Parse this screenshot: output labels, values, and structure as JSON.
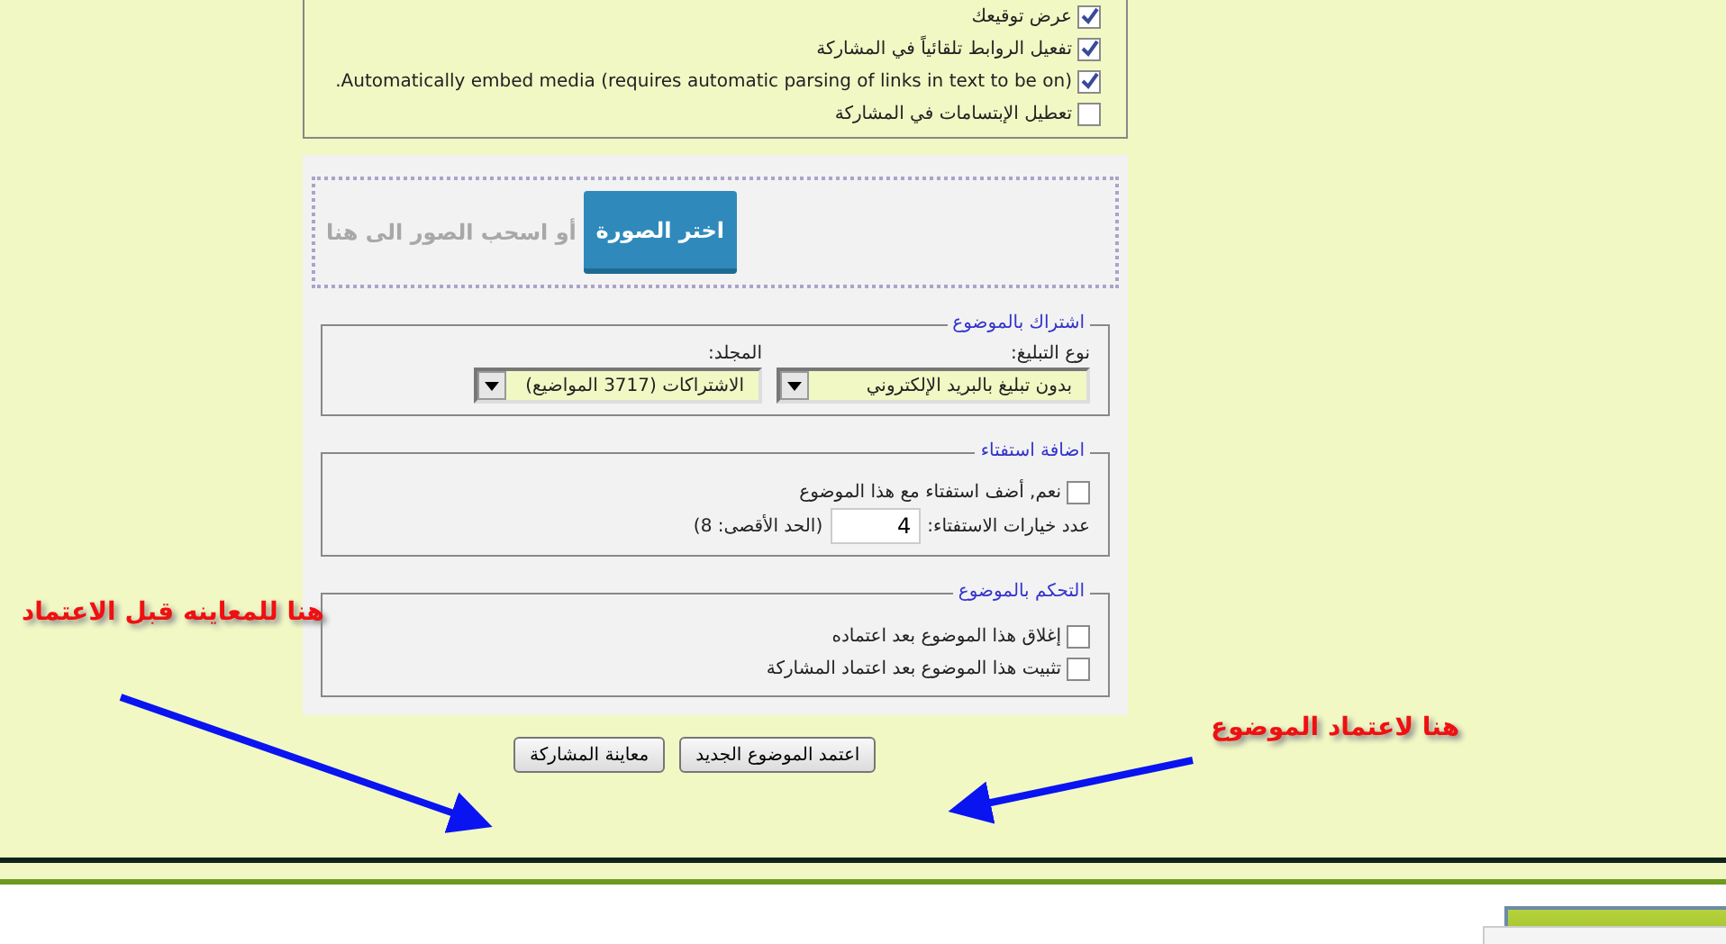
{
  "options": [
    {
      "label": "عرض توقيعك",
      "checked": true
    },
    {
      "label": "تفعيل الروابط تلقائياً في المشاركة",
      "checked": true
    },
    {
      "label": "Automatically embed media (requires automatic parsing of links in text to be on).",
      "checked": true
    },
    {
      "label": "تعطيل الإبتسامات في المشاركة",
      "checked": false
    }
  ],
  "upload": {
    "button": "اختر الصورة",
    "hint": "أو اسحب الصور الى هنا"
  },
  "subscription": {
    "legend": "اشتراك بالموضوع",
    "notify_label": "نوع التبليغ:",
    "notify_value": "بدون تبليغ بالبريد الإلكتروني",
    "folder_label": "المجلد:",
    "folder_value": "الاشتراكات (3717 المواضيع)"
  },
  "poll": {
    "legend": "اضافة استفتاء",
    "add": {
      "label": "نعم, أضف استفتاء مع هذا الموضوع",
      "checked": false
    },
    "count_label": "عدد خيارات الاستفتاء:",
    "count_value": "4",
    "max_note": "(الحد الأقصى: 8)"
  },
  "moderation": {
    "legend": "التحكم بالموضوع",
    "options": [
      {
        "label": "إغلاق هذا الموضوع بعد اعتماده",
        "checked": false
      },
      {
        "label": "تثبيت هذا الموضوع بعد اعتماد المشاركة",
        "checked": false
      }
    ]
  },
  "buttons": [
    "اعتمد الموضوع الجديد",
    "معاينة المشاركة"
  ],
  "annotations": [
    "هنا للمعاينه قبل الاعتماد",
    "هنا لاعتماد الموضوع"
  ]
}
